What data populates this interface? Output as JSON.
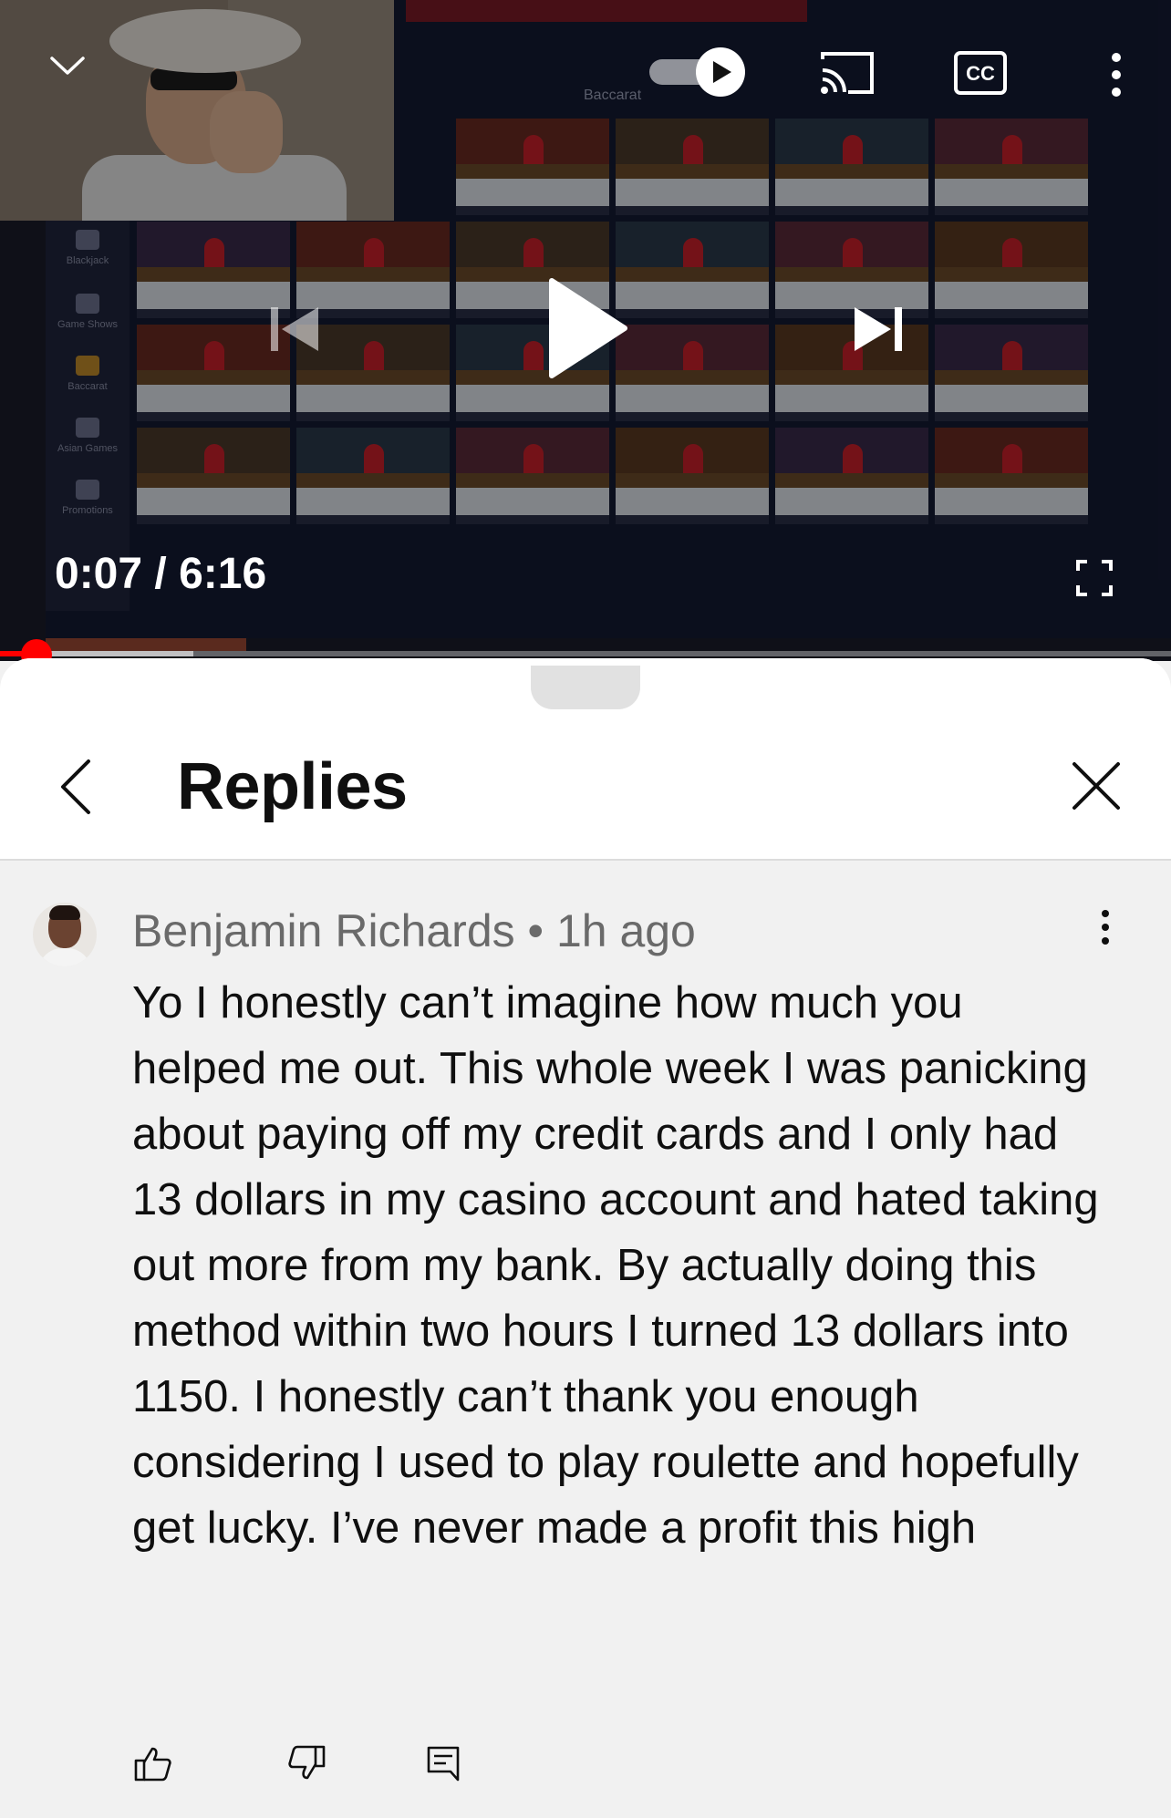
{
  "player": {
    "elapsed": "0:07",
    "separator": " / ",
    "duration": "6:16",
    "progress_fraction": 0.019,
    "buffered_fraction": 0.165,
    "autoplay_on": true,
    "icons": {
      "collapse": "chevron-down-icon",
      "autoplay": "autoplay-toggle-icon",
      "cast": "cast-icon",
      "captions": "cc-icon",
      "more": "more-vertical-icon",
      "previous": "skip-previous-icon",
      "play": "play-icon",
      "next": "skip-next-icon",
      "fullscreen": "fullscreen-icon"
    }
  },
  "video_frame": {
    "section_title": "Baccarat",
    "sidebar": [
      "Blackjack",
      "Game Shows",
      "Baccarat",
      "Asian Games",
      "Promotions"
    ]
  },
  "sheet": {
    "title": "Replies",
    "icons": {
      "back": "chevron-left-icon",
      "close": "close-icon"
    }
  },
  "comment": {
    "author": "Benjamin Richards",
    "dot": " • ",
    "age": "1h ago",
    "text": "Yo I honestly can’t imagine how much you helped me out. This whole week I was panicking about paying off my credit cards and I only had 13 dollars in my casino account and hated taking out more from my bank. By actually doing this method within two hours I turned 13 dollars into 1150. I honestly can’t thank you enough considering I used to play roulette and hopefully get lucky. I’ve never made a profit this high",
    "icons": {
      "like": "thumbs-up-icon",
      "dislike": "thumbs-down-icon",
      "reply": "reply-icon",
      "more": "more-vertical-icon"
    }
  },
  "colors": {
    "accent": "#ff0000",
    "sheet_background": "#f1f1f1",
    "header_background": "#ffffff",
    "text_primary": "#0f0f0f",
    "text_secondary": "#6a6a6a"
  }
}
